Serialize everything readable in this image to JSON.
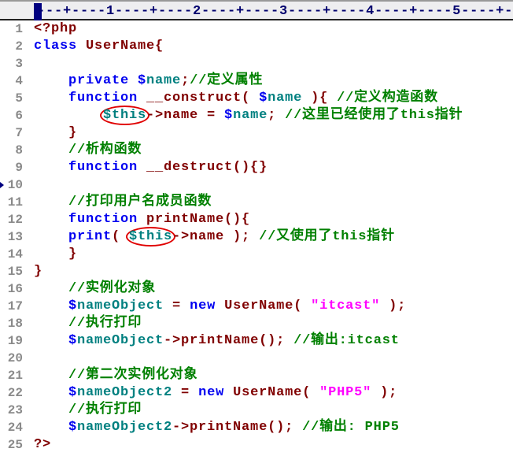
{
  "ruler": {
    "text": "---+----1----+----2----+----3----+----4----+----5----+-"
  },
  "editor": {
    "lines": [
      {
        "n": "1",
        "tokens": [
          [
            "i",
            "<?php"
          ]
        ]
      },
      {
        "n": "2",
        "tokens": [
          [
            "k",
            "class "
          ],
          [
            "i",
            "UserName{"
          ]
        ]
      },
      {
        "n": "3",
        "tokens": []
      },
      {
        "n": "4",
        "tokens": [
          [
            "k",
            "    private "
          ],
          [
            "d",
            "$"
          ],
          [
            "v",
            "name"
          ],
          [
            "i",
            ";"
          ],
          [
            "c",
            "//定义属性"
          ]
        ]
      },
      {
        "n": "5",
        "tokens": [
          [
            "k",
            "    function "
          ],
          [
            "i",
            "__construct( "
          ],
          [
            "d",
            "$"
          ],
          [
            "v",
            "name"
          ],
          [
            "i",
            " ){ "
          ],
          [
            "c",
            "//定义构造函数"
          ]
        ]
      },
      {
        "n": "6",
        "tokens": [
          [
            "i",
            "        "
          ],
          [
            "v",
            "$this",
            "circled"
          ],
          [
            "i",
            "->name = "
          ],
          [
            "d",
            "$"
          ],
          [
            "v",
            "name"
          ],
          [
            "i",
            "; "
          ],
          [
            "c",
            "//这里已经使用了this指针"
          ]
        ]
      },
      {
        "n": "7",
        "tokens": [
          [
            "i",
            "    }"
          ]
        ]
      },
      {
        "n": "8",
        "tokens": [
          [
            "c",
            "    //析构函数"
          ]
        ]
      },
      {
        "n": "9",
        "tokens": [
          [
            "k",
            "    function "
          ],
          [
            "i",
            "__destruct(){}"
          ]
        ]
      },
      {
        "n": "10",
        "tokens": [],
        "bookmark": true
      },
      {
        "n": "11",
        "tokens": [
          [
            "c",
            "    //打印用户名成员函数"
          ]
        ]
      },
      {
        "n": "12",
        "tokens": [
          [
            "k",
            "    function "
          ],
          [
            "i",
            "printName(){"
          ]
        ]
      },
      {
        "n": "13",
        "tokens": [
          [
            "k",
            "    print"
          ],
          [
            "i",
            "( "
          ],
          [
            "v",
            "$this",
            "circled"
          ],
          [
            "i",
            "->name ); "
          ],
          [
            "c",
            "//又使用了this指针"
          ]
        ]
      },
      {
        "n": "14",
        "tokens": [
          [
            "i",
            "    }"
          ]
        ]
      },
      {
        "n": "15",
        "tokens": [
          [
            "i",
            "}"
          ]
        ]
      },
      {
        "n": "16",
        "tokens": [
          [
            "c",
            "    //实例化对象"
          ]
        ]
      },
      {
        "n": "17",
        "tokens": [
          [
            "d",
            "    $"
          ],
          [
            "v",
            "nameObject"
          ],
          [
            "i",
            " = "
          ],
          [
            "k",
            "new "
          ],
          [
            "i",
            "UserName( "
          ],
          [
            "s",
            "\"itcast\""
          ],
          [
            "i",
            " );"
          ]
        ]
      },
      {
        "n": "18",
        "tokens": [
          [
            "c",
            "    //执行打印"
          ]
        ]
      },
      {
        "n": "19",
        "tokens": [
          [
            "d",
            "    $"
          ],
          [
            "v",
            "nameObject"
          ],
          [
            "i",
            "->printName(); "
          ],
          [
            "c",
            "//输出:itcast"
          ]
        ]
      },
      {
        "n": "20",
        "tokens": []
      },
      {
        "n": "21",
        "tokens": [
          [
            "c",
            "    //第二次实例化对象"
          ]
        ]
      },
      {
        "n": "22",
        "tokens": [
          [
            "d",
            "    $"
          ],
          [
            "v",
            "nameObject2"
          ],
          [
            "i",
            " = "
          ],
          [
            "k",
            "new "
          ],
          [
            "i",
            "UserName( "
          ],
          [
            "s",
            "\"PHP5\""
          ],
          [
            "i",
            " );"
          ]
        ]
      },
      {
        "n": "23",
        "tokens": [
          [
            "c",
            "    //执行打印"
          ]
        ]
      },
      {
        "n": "24",
        "tokens": [
          [
            "d",
            "    $"
          ],
          [
            "v",
            "nameObject2"
          ],
          [
            "i",
            "->printName(); "
          ],
          [
            "c",
            "//输出: PHP5"
          ]
        ]
      },
      {
        "n": "25",
        "tokens": [
          [
            "i",
            "?>"
          ]
        ]
      }
    ]
  }
}
